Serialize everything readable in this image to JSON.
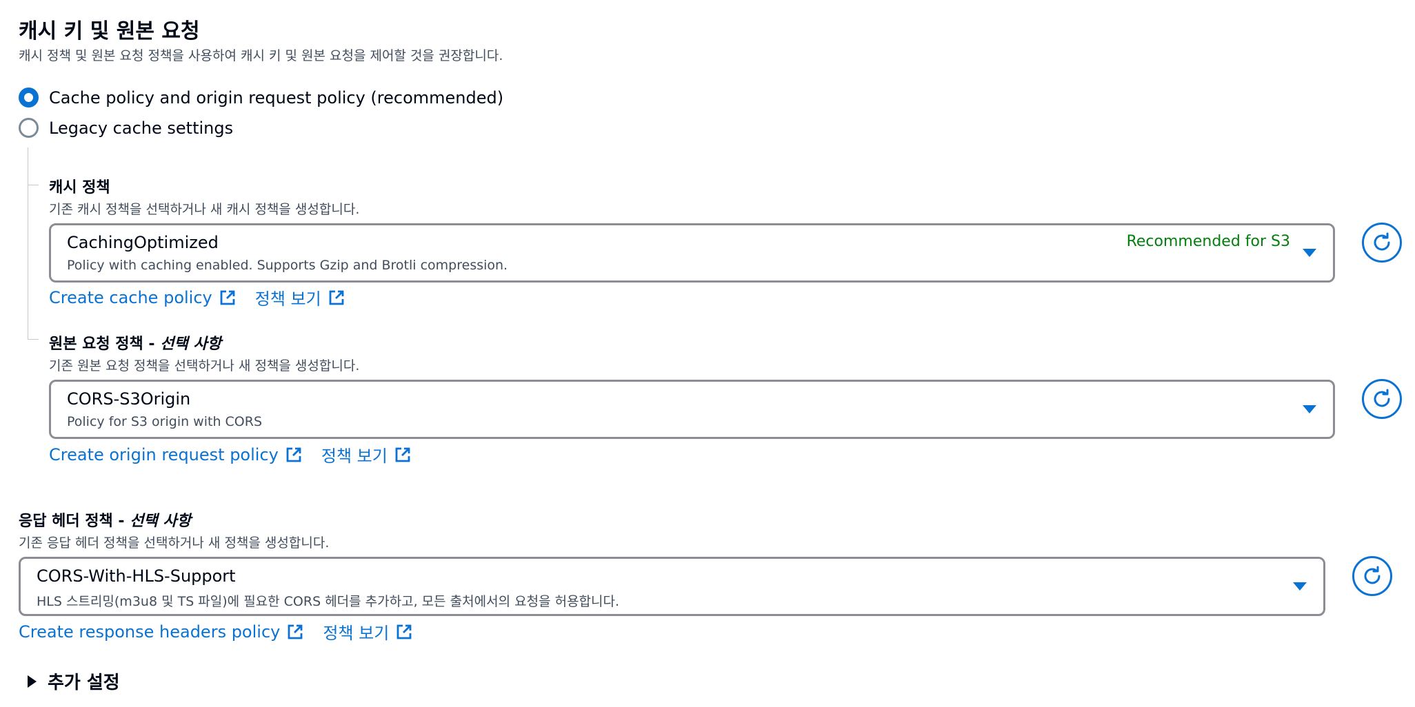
{
  "section": {
    "title": "캐시 키 및 원본 요청",
    "description": "캐시 정책 및 원본 요청 정책을 사용하여 캐시 키 및 원본 요청을 제어할 것을 권장합니다."
  },
  "options": [
    {
      "label": "Cache policy and origin request policy (recommended)",
      "selected": true
    },
    {
      "label": "Legacy cache settings",
      "selected": false
    }
  ],
  "cache_policy": {
    "label": "캐시 정책",
    "description": "기존 캐시 정책을 선택하거나 새 캐시 정책을 생성합니다.",
    "selected_title": "CachingOptimized",
    "selected_subtitle": "Policy with caching enabled. Supports Gzip and Brotli compression.",
    "tag": "Recommended for S3",
    "create_link": "Create cache policy",
    "view_link": "정책 보기"
  },
  "origin_request_policy": {
    "label": "원본 요청 정책 - ",
    "label_optional": "선택 사항",
    "description": "기존 원본 요청 정책을 선택하거나 새 정책을 생성합니다.",
    "selected_title": "CORS-S3Origin",
    "selected_subtitle": "Policy for S3 origin with CORS",
    "create_link": "Create origin request policy",
    "view_link": "정책 보기"
  },
  "response_headers_policy": {
    "label": "응답 헤더 정책 - ",
    "label_optional": "선택 사항",
    "description": "기존 응답 헤더 정책을 선택하거나 새 정책을 생성합니다.",
    "selected_title": "CORS-With-HLS-Support",
    "selected_subtitle": "HLS 스트리밍(m3u8 및 TS 파일)에 필요한 CORS 헤더를 추가하고, 모든 출처에서의 요청을 허용합니다.",
    "create_link": "Create response headers policy",
    "view_link": "정책 보기"
  },
  "additional_settings": {
    "label": "추가 설정"
  },
  "colors": {
    "link": "#0972d3",
    "recommended": "#037f0c",
    "text": "#000716",
    "secondary_text": "#414d5c"
  }
}
